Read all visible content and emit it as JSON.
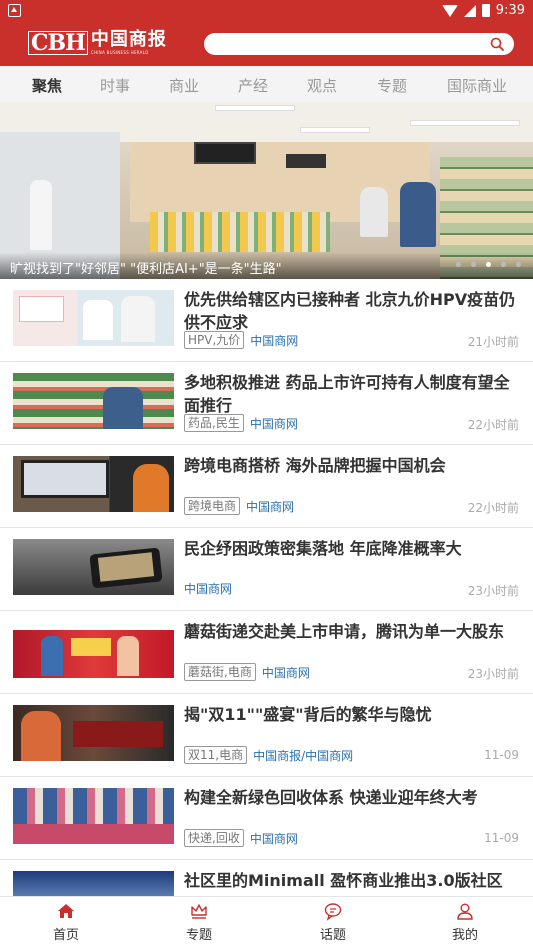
{
  "status_bar": {
    "time": "9:39"
  },
  "header": {
    "logo_latin": "CBH",
    "logo_chinese": "中国商报",
    "logo_subtitle": "CHINA BUSINESS HERALD",
    "search_placeholder": ""
  },
  "tabs": [
    "聚焦",
    "时事",
    "商业",
    "产经",
    "观点",
    "专题",
    "国际商业"
  ],
  "active_tab": "聚焦",
  "banner": {
    "caption": "旷视找到了\"好邻居\" \"便利店AI+\"是一条\"生路\"",
    "dots": 5,
    "active_dot": 3
  },
  "articles": [
    {
      "title": "优先供给辖区内已接种者 北京九价HPV疫苗仍供不应求",
      "tags": "HPV,九价",
      "source": "中国商网",
      "time": "21小时前"
    },
    {
      "title": "多地积极推进 药品上市许可持有人制度有望全面推行",
      "tags": "药品,民生",
      "source": "中国商网",
      "time": "22小时前"
    },
    {
      "title": "跨境电商搭桥 海外品牌把握中国机会",
      "tags": "跨境电商",
      "source": "中国商网",
      "time": "22小时前"
    },
    {
      "title": "民企纾困政策密集落地 年底降准概率大",
      "tags": "",
      "source": "中国商网",
      "time": "23小时前"
    },
    {
      "title": "蘑菇街递交赴美上市申请，腾讯为单一大股东",
      "tags": "蘑菇街,电商",
      "source": "中国商网",
      "time": "23小时前"
    },
    {
      "title": "揭\"双11\"\"盛宴\"背后的繁华与隐忧",
      "tags": "双11,电商",
      "source": "中国商报/中国商网",
      "time": "11-09"
    },
    {
      "title": "构建全新绿色回收体系 快递业迎年终大考",
      "tags": "快递,回收",
      "source": "中国商网",
      "time": "11-09"
    },
    {
      "title": "社区里的Minimall 盈怀商业推出3.0版社区",
      "tags": "",
      "source": "",
      "time": ""
    }
  ],
  "bottom_nav": [
    {
      "label": "首页",
      "icon": "home-icon",
      "active": true
    },
    {
      "label": "专题",
      "icon": "crown-icon",
      "active": false
    },
    {
      "label": "话题",
      "icon": "chat-icon",
      "active": false
    },
    {
      "label": "我的",
      "icon": "user-icon",
      "active": false
    }
  ],
  "colors": {
    "brand_red": "#c9302c",
    "link_blue": "#2a6fb0"
  }
}
